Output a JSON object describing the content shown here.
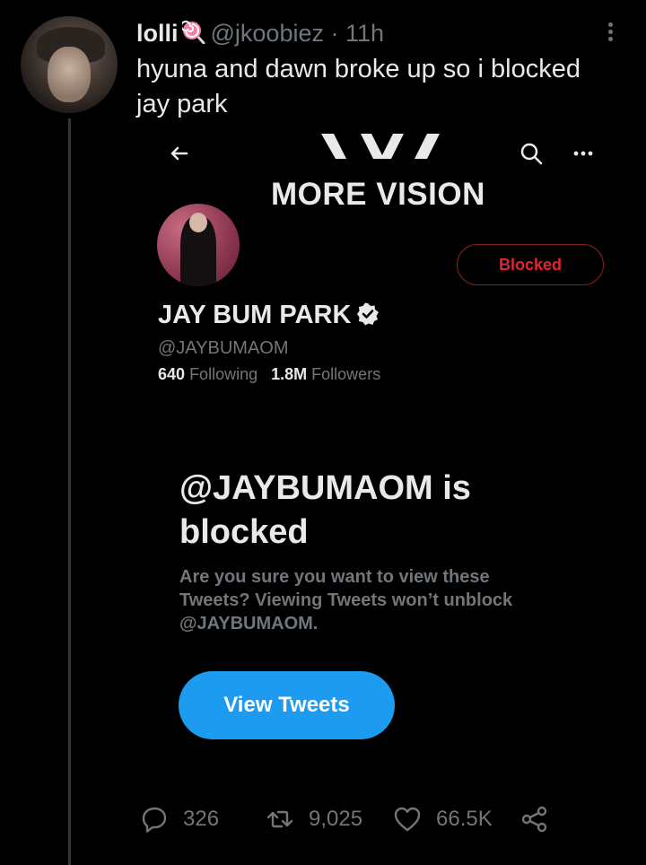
{
  "tweet": {
    "author_name": "lolli",
    "author_handle": "@jkoobiez",
    "separator": "·",
    "time": "11h",
    "text": "hyuna and dawn broke up so i blocked jay park",
    "stats": {
      "replies": "326",
      "retweets": "9,025",
      "likes": "66.5K"
    }
  },
  "embedded": {
    "brand": "MORE VISION",
    "blocked_button": "Blocked",
    "display_name": "JAY BUM PARK",
    "handle": "@JAYBUMAOM",
    "following_count": "640",
    "following_label": "Following",
    "followers_count": "1.8M",
    "followers_label": "Followers",
    "blocked_title": "@JAYBUMAOM is blocked",
    "blocked_desc": "Are you sure you want to view these Tweets? Viewing Tweets won’t unblock @JAYBUMAOM.",
    "view_button": "View Tweets"
  },
  "colors": {
    "background": "#000000",
    "text": "#e7e9ea",
    "muted": "#71767b",
    "accent_blue": "#1d9bf0",
    "blocked_red": "#e0252e"
  },
  "icons": [
    "lollipop-icon",
    "more-icon",
    "back-arrow-icon",
    "search-icon",
    "dots-icon",
    "verified-icon",
    "reply-icon",
    "retweet-icon",
    "like-icon",
    "share-icon"
  ]
}
